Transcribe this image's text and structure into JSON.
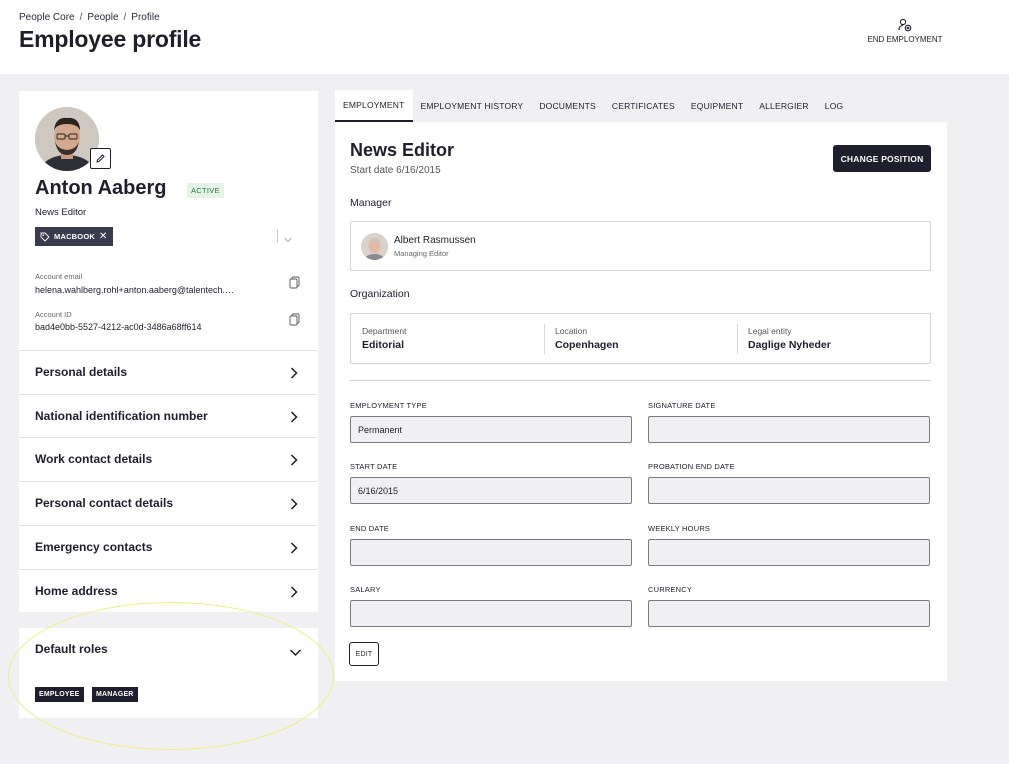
{
  "header": {
    "breadcrumb": [
      "People Core",
      "People",
      "Profile"
    ],
    "separator": "/",
    "title": "Employee profile",
    "end_employment_label": "END EMPLOYMENT"
  },
  "profile": {
    "name": "Anton Aaberg",
    "status": "ACTIVE",
    "job_title": "News Editor",
    "tags": [
      {
        "label": "MACBOOK",
        "remove": "✕"
      }
    ],
    "account_email_label": "Account email",
    "account_email": "helena.wahlberg.rohl+anton.aaberg@talentech.com",
    "account_id_label": "Account ID",
    "account_id": "bad4e0bb-5527-4212-ac0d-3486a68ff614"
  },
  "sections": [
    {
      "label": "Personal details"
    },
    {
      "label": "National identification number"
    },
    {
      "label": "Work contact details"
    },
    {
      "label": "Personal contact details"
    },
    {
      "label": "Emergency contacts"
    },
    {
      "label": "Home address"
    }
  ],
  "roles": {
    "title": "Default roles",
    "items": [
      "EMPLOYEE",
      "MANAGER"
    ]
  },
  "tabs": [
    "EMPLOYMENT",
    "EMPLOYMENT HISTORY",
    "DOCUMENTS",
    "CERTIFICATES",
    "EQUIPMENT",
    "ALLERGIER",
    "LOG"
  ],
  "active_tab": "EMPLOYMENT",
  "position": {
    "title": "News Editor",
    "start_date": "Start date 6/16/2015",
    "change_button": "CHANGE POSITION"
  },
  "manager": {
    "heading": "Manager",
    "name": "Albert Rasmussen",
    "role": "Managing Editor"
  },
  "organization": {
    "heading": "Organization",
    "department_label": "Department",
    "department": "Editorial",
    "location_label": "Location",
    "location": "Copenhagen",
    "legal_entity_label": "Legal entity",
    "legal_entity": "Daglige Nyheder"
  },
  "fields": {
    "employment_type_label": "EMPLOYMENT TYPE",
    "employment_type": "Permanent",
    "signature_date_label": "SIGNATURE DATE",
    "signature_date": "",
    "start_date_label": "START DATE",
    "start_date": "6/16/2015",
    "probation_end_date_label": "PROBATION END DATE",
    "probation_end_date": "",
    "end_date_label": "END DATE",
    "end_date": "",
    "weekly_hours_label": "WEEKLY HOURS",
    "weekly_hours": "",
    "salary_label": "SALARY",
    "salary": "",
    "currency_label": "CURRENCY",
    "currency": ""
  },
  "edit_button": "EDIT",
  "colors": {
    "primary": "#1e1e2d",
    "background": "#f0f0f3",
    "active_badge_bg": "#e3f3e6",
    "active_badge_text": "#2d7a46",
    "highlight": "#eeee88"
  }
}
